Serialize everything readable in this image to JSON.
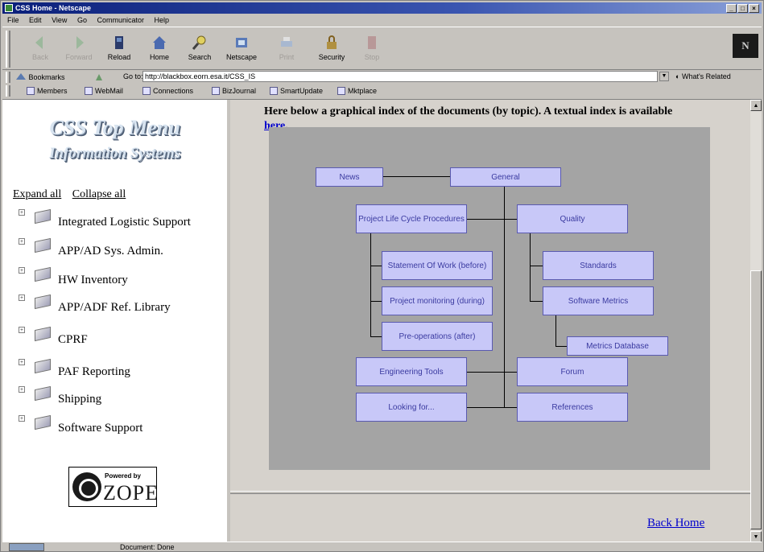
{
  "window": {
    "title": "CSS Home - Netscape"
  },
  "menu": [
    "File",
    "Edit",
    "View",
    "Go",
    "Communicator",
    "Help"
  ],
  "toolbar": {
    "buttons": [
      {
        "label": "Back",
        "enabled": false
      },
      {
        "label": "Forward",
        "enabled": false
      },
      {
        "label": "Reload",
        "enabled": true
      },
      {
        "label": "Home",
        "enabled": true
      },
      {
        "label": "Search",
        "enabled": true
      },
      {
        "label": "Netscape",
        "enabled": true
      },
      {
        "label": "Print",
        "enabled": false
      },
      {
        "label": "Security",
        "enabled": true
      },
      {
        "label": "Stop",
        "enabled": false
      }
    ]
  },
  "location": {
    "bookmarks_label": "Bookmarks",
    "goto_label": "Go to:",
    "url": "http://blackbox.eorn.esa.it/CSS_IS",
    "related_label": "What's Related"
  },
  "personal_toolbar": [
    "Members",
    "WebMail",
    "Connections",
    "BizJournal",
    "SmartUpdate",
    "Mktplace"
  ],
  "left": {
    "title_line1": "CSS Top Menu",
    "title_line2": "Information Systems",
    "expand_all": "Expand all",
    "collapse_all": "Collapse all",
    "tree": [
      "Integrated Logistic Support",
      "APP/AD Sys. Admin.",
      "HW Inventory",
      "APP/ADF Ref. Library",
      "CPRF",
      "PAF Reporting",
      "Shipping",
      "Software Support"
    ],
    "badge": {
      "top": "Powered by",
      "word": "ZOPE"
    }
  },
  "right": {
    "intro": "Here below a graphical index of the documents (by topic). A textual index is available",
    "intro_link": "here",
    "intro_end": ".",
    "nodes": {
      "news": "News",
      "general": "General",
      "plc": "Project Life Cycle Procedures",
      "quality": "Quality",
      "sow": "Statement Of Work (before)",
      "monitoring": "Project monitoring (during)",
      "preops": "Pre-operations (after)",
      "standards": "Standards",
      "metrics": "Software Metrics",
      "metricsdb": "Metrics Database",
      "engtools": "Engineering Tools",
      "forum": "Forum",
      "looking": "Looking for...",
      "references": "References"
    },
    "back_home": "Back Home"
  },
  "status": {
    "text": "Document: Done"
  },
  "colors": {
    "title_bar": "#0a1f7a",
    "node_fill": "#c8c8f8",
    "node_text": "#3a3aa0",
    "link": "#0000cc"
  }
}
